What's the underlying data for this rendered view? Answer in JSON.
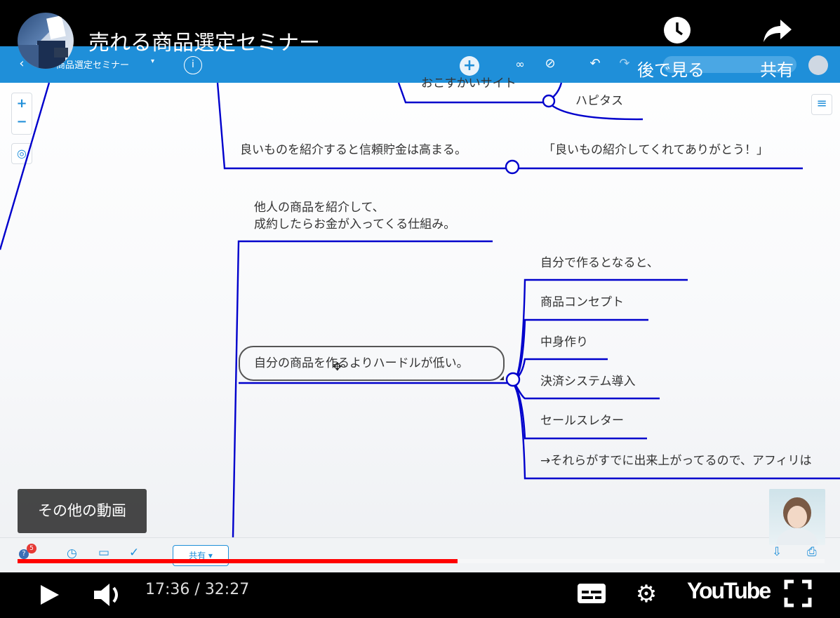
{
  "video": {
    "title": "売れる商品選定セミナー",
    "watch_later_label": "後で見る",
    "share_label": "共有",
    "more_videos_label": "その他の動画",
    "time_current": "17:36",
    "time_separator": " / ",
    "time_total": "32:27",
    "brand": "YouTube",
    "progress_fraction": 0.545
  },
  "app": {
    "map_title": "商品選定セミナー",
    "share_dropdown_label": "共有",
    "notification_count": "5",
    "accent_color": "#1f8fd9",
    "branch_color": "#0000cc"
  },
  "mindmap": {
    "nodes": {
      "osusume": "おこすかいサイト",
      "hapitas": "ハピタス",
      "trust": "良いものを紹介すると信頼貯金は高まる。",
      "thanks": "「良いもの紹介してくれてありがとう！」",
      "affiliate_line1": "他人の商品を紹介して、",
      "affiliate_line2": "成約したらお金が入ってくる仕組み。",
      "hurdle": "自分の商品を作るよりハードルが低い。",
      "own_make": "自分で作るとなると、",
      "concept": "商品コンセプト",
      "content": "中身作り",
      "payment": "決済システム導入",
      "sales_letter": "セールスレター",
      "already": "→それらがすでに出来上がってるので、アフィリは"
    }
  }
}
